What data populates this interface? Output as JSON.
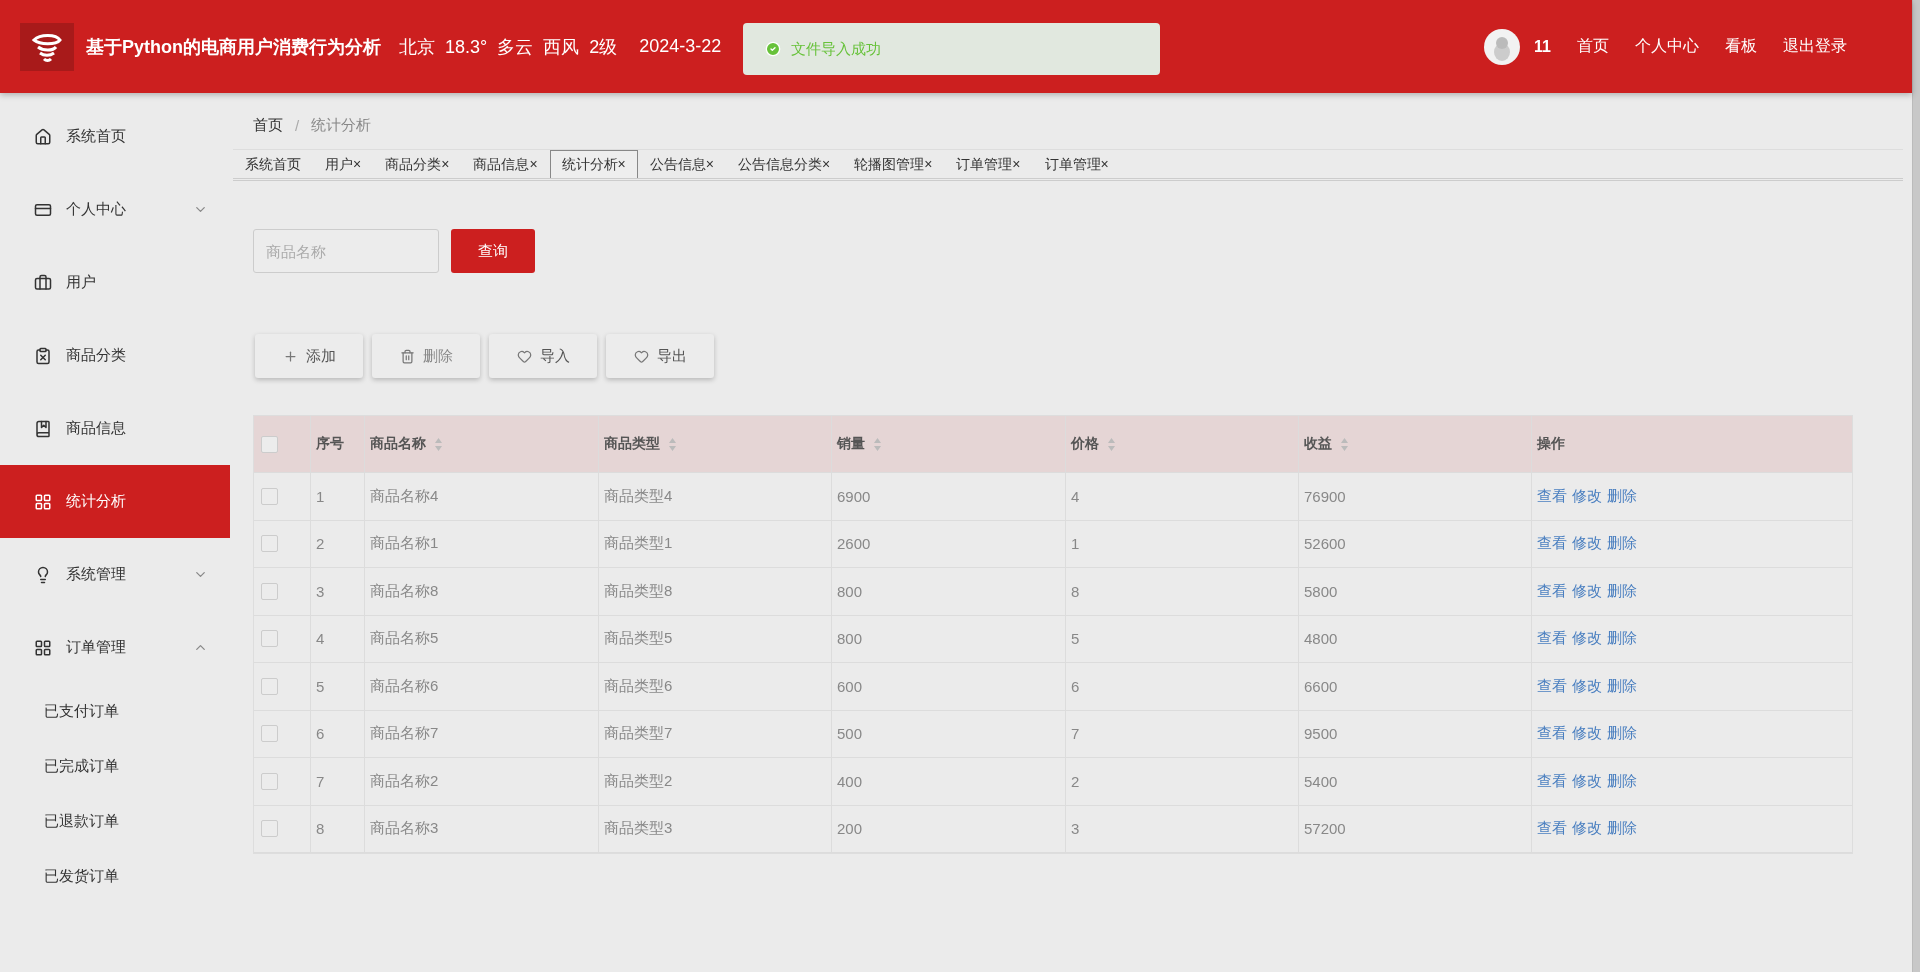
{
  "header": {
    "title": "基于Python的电商用户消费行为分析",
    "weather": "北京  18.3°  多云  西风  2级",
    "date": "2024-3-22",
    "user": "11",
    "nav": [
      "首页",
      "个人中心",
      "看板",
      "退出登录"
    ]
  },
  "toast": {
    "message": "文件导入成功"
  },
  "sidebar": {
    "items": [
      {
        "label": "系统首页",
        "kind": "item",
        "selected": false
      },
      {
        "label": "个人中心",
        "kind": "group",
        "selected": false,
        "expanded": false
      },
      {
        "label": "用户",
        "kind": "item",
        "selected": false
      },
      {
        "label": "商品分类",
        "kind": "item",
        "selected": false
      },
      {
        "label": "商品信息",
        "kind": "item",
        "selected": false
      },
      {
        "label": "统计分析",
        "kind": "item",
        "selected": true
      },
      {
        "label": "系统管理",
        "kind": "group",
        "selected": false,
        "expanded": false
      },
      {
        "label": "订单管理",
        "kind": "group",
        "selected": false,
        "expanded": true,
        "children": [
          {
            "label": "已支付订单",
            "selected": false
          },
          {
            "label": "已完成订单",
            "selected": false
          },
          {
            "label": "已退款订单",
            "selected": false
          },
          {
            "label": "已发货订单",
            "selected": false
          }
        ]
      }
    ]
  },
  "breadcrumb": [
    {
      "label": "首页"
    },
    {
      "separator": "/",
      "label": "统计分析"
    }
  ],
  "tabs": [
    {
      "label": "系统首页",
      "selected": false
    },
    {
      "label": "用户",
      "selected": false,
      "close": "×"
    },
    {
      "label": "商品分类",
      "selected": false,
      "close": "×"
    },
    {
      "label": "商品信息",
      "selected": false,
      "close": "×"
    },
    {
      "label": "统计分析",
      "selected": true,
      "close": "×"
    },
    {
      "label": "公告信息",
      "selected": false,
      "close": "×"
    },
    {
      "label": "公告信息分类",
      "selected": false,
      "close": "×"
    },
    {
      "label": "轮播图管理",
      "selected": false,
      "close": "×"
    },
    {
      "label": "订单管理",
      "selected": false,
      "close": "×"
    },
    {
      "label": "订单管理",
      "selected": false,
      "close": "×"
    }
  ],
  "search": {
    "placeholder": "商品名称",
    "button": "查询"
  },
  "actions": [
    {
      "label": "添加",
      "kind": "add"
    },
    {
      "label": "删除",
      "kind": "delete"
    },
    {
      "label": "导入",
      "kind": "import"
    },
    {
      "label": "导出",
      "kind": "export"
    }
  ],
  "table": {
    "columns": [
      {
        "label": "序号",
        "sortable": false
      },
      {
        "label": "商品名称",
        "sortable": true
      },
      {
        "label": "商品类型",
        "sortable": true
      },
      {
        "label": "销量",
        "sortable": true
      },
      {
        "label": "价格",
        "sortable": true
      },
      {
        "label": "收益",
        "sortable": true
      },
      {
        "label": "操作",
        "sortable": false
      }
    ],
    "select_all": {
      "checked": false
    },
    "rows": [
      {
        "checked": false,
        "cells": [
          "1",
          "商品名称4",
          "商品类型4",
          "6900",
          "4",
          "76900"
        ],
        "actions": [
          "查看",
          "修改",
          "删除"
        ]
      },
      {
        "checked": false,
        "cells": [
          "2",
          "商品名称1",
          "商品类型1",
          "2600",
          "1",
          "52600"
        ],
        "actions": [
          "查看",
          "修改",
          "删除"
        ]
      },
      {
        "checked": false,
        "cells": [
          "3",
          "商品名称8",
          "商品类型8",
          "800",
          "8",
          "5800"
        ],
        "actions": [
          "查看",
          "修改",
          "删除"
        ]
      },
      {
        "checked": false,
        "cells": [
          "4",
          "商品名称5",
          "商品类型5",
          "800",
          "5",
          "4800"
        ],
        "actions": [
          "查看",
          "修改",
          "删除"
        ]
      },
      {
        "checked": false,
        "cells": [
          "5",
          "商品名称6",
          "商品类型6",
          "600",
          "6",
          "6600"
        ],
        "actions": [
          "查看",
          "修改",
          "删除"
        ]
      },
      {
        "checked": false,
        "cells": [
          "6",
          "商品名称7",
          "商品类型7",
          "500",
          "7",
          "9500"
        ],
        "actions": [
          "查看",
          "修改",
          "删除"
        ]
      },
      {
        "checked": false,
        "cells": [
          "7",
          "商品名称2",
          "商品类型2",
          "400",
          "2",
          "5400"
        ],
        "actions": [
          "查看",
          "修改",
          "删除"
        ]
      },
      {
        "checked": false,
        "cells": [
          "8",
          "商品名称3",
          "商品类型3",
          "200",
          "3",
          "57200"
        ],
        "actions": [
          "查看",
          "修改",
          "删除"
        ]
      }
    ]
  }
}
